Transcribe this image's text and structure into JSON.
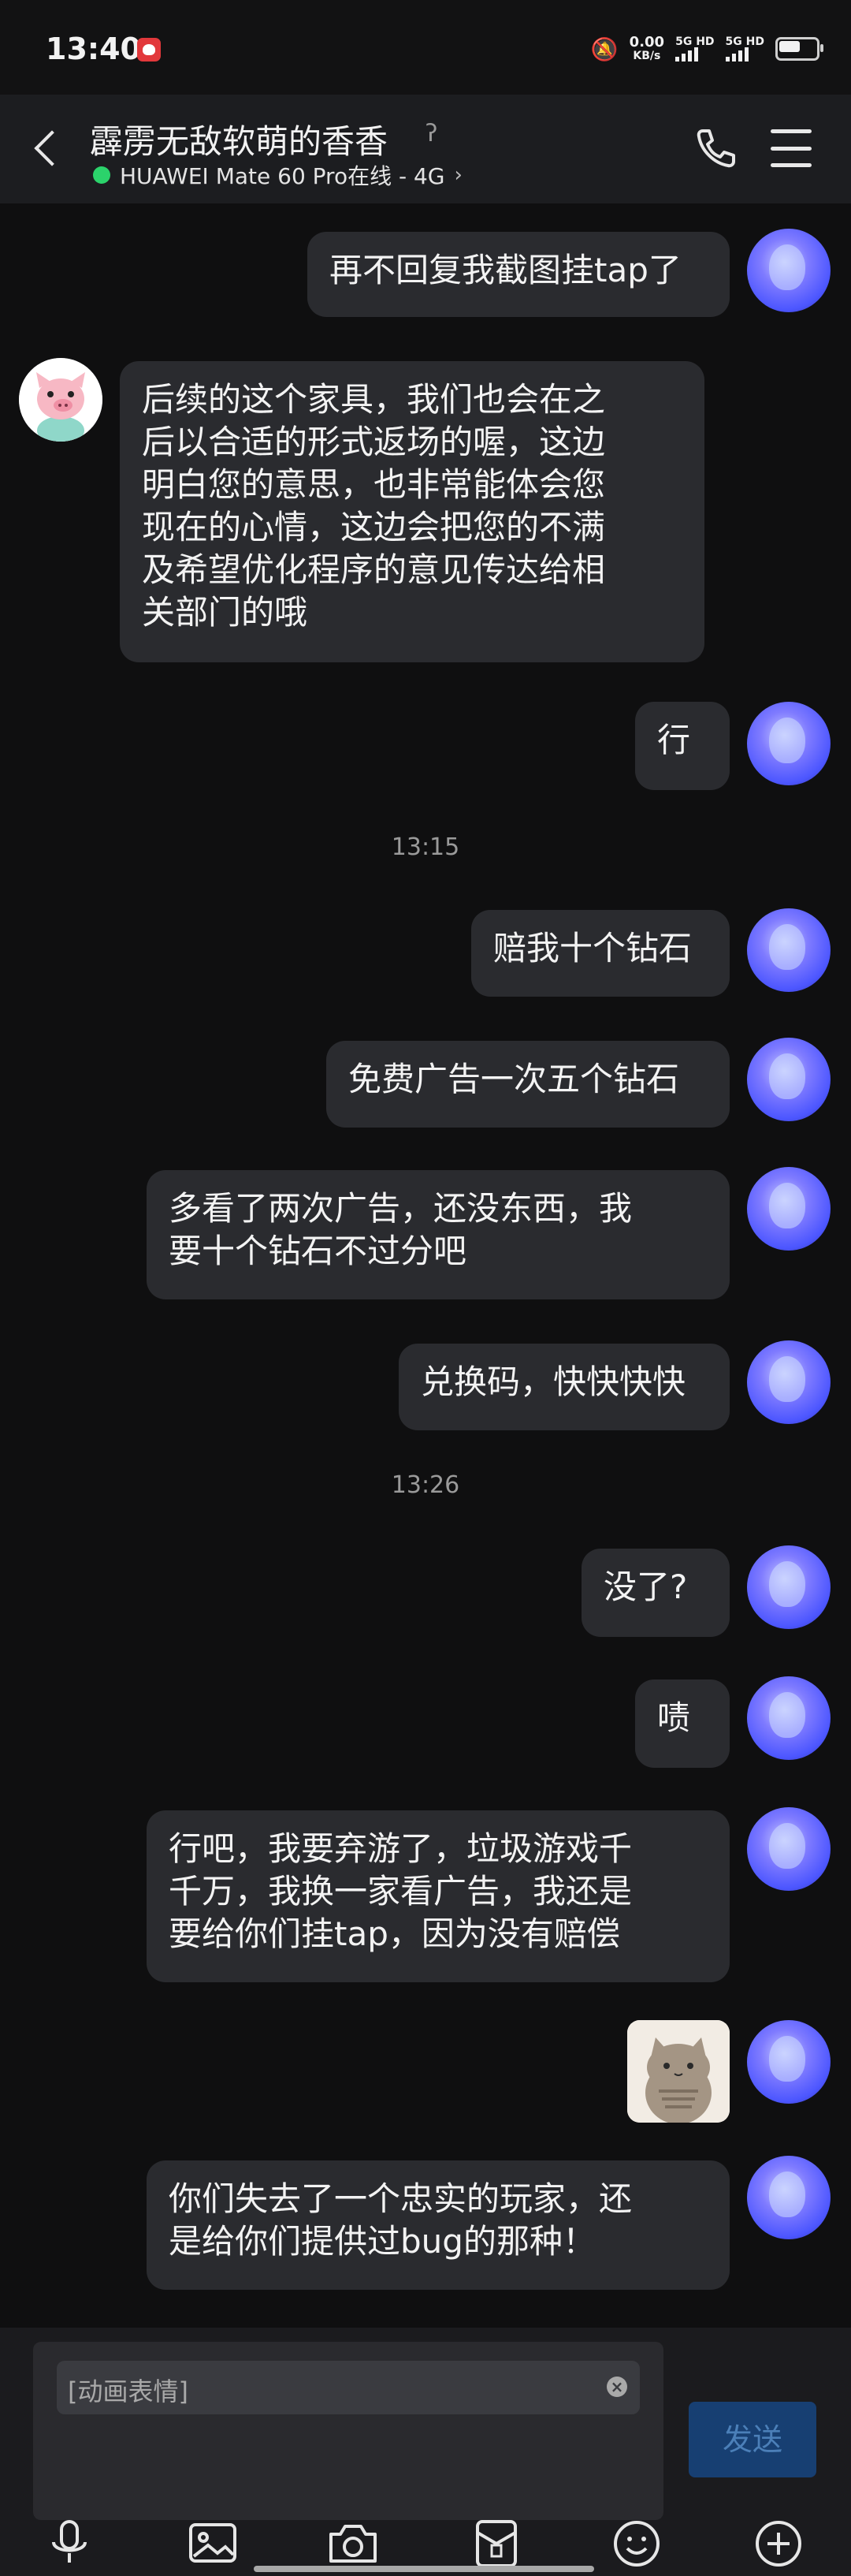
{
  "status_bar": {
    "time": "13:40",
    "speed_value": "0.00",
    "speed_unit": "KB/s",
    "sim1": "5G HD",
    "sim2": "5G HD"
  },
  "header": {
    "title": "霹雳无敌软萌的香香",
    "subtitle": "HUAWEI Mate 60 Pro在线 - 4G"
  },
  "messages": [
    {
      "side": "right",
      "text": "再不回复我截图挂tap了"
    },
    {
      "side": "left",
      "text": "后续的这个家具，我们也会在之\n后以合适的形式返场的喔，这边\n明白您的意思，也非常能体会您\n现在的心情，这边会把您的不满\n及希望优化程序的意见传达给相\n关部门的哦"
    },
    {
      "side": "right",
      "text": "行"
    },
    {
      "type": "timestamp",
      "text": "13:15"
    },
    {
      "side": "right",
      "text": "赔我十个钻石"
    },
    {
      "side": "right",
      "text": "免费广告一次五个钻石"
    },
    {
      "side": "right",
      "text": "多看了两次广告，还没东西，我\n要十个钻石不过分吧"
    },
    {
      "side": "right",
      "text": "兑换码，快快快快"
    },
    {
      "type": "timestamp",
      "text": "13:26"
    },
    {
      "side": "right",
      "text": "没了?"
    },
    {
      "side": "right",
      "text": "啧"
    },
    {
      "side": "right",
      "text": "行吧，我要弃游了，垃圾游戏千\n千万，我换一家看广告，我还是\n要给你们挂tap，因为没有赔偿"
    },
    {
      "side": "right",
      "type": "sticker",
      "icon": "cat-sticker"
    },
    {
      "side": "right",
      "text": "你们失去了一个忠实的玩家，还\n是给你们提供过bug的那种！"
    }
  ],
  "input": {
    "chip_text": "[动画表情]",
    "send_label": "发送"
  },
  "toolbar": [
    "mic-icon",
    "image-icon",
    "camera-icon",
    "red-packet-icon",
    "emoji-icon",
    "plus-icon"
  ],
  "colors": {
    "background": "#0f0f10",
    "bubble": "#2a2b2f",
    "online": "#2bd36b",
    "send": "#173f72"
  }
}
